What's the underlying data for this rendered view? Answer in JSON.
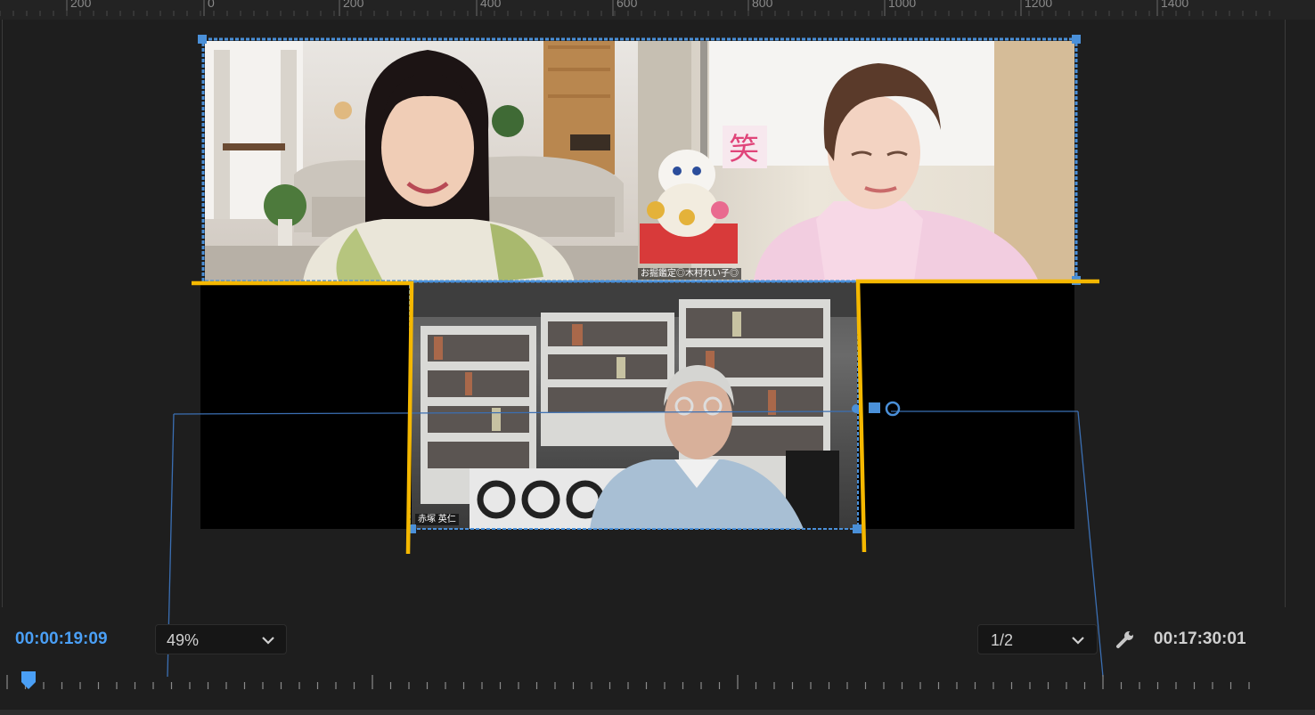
{
  "ruler": {
    "labels": [
      "200",
      "0",
      "200",
      "400",
      "600",
      "800",
      "1000",
      "1200",
      "1400"
    ]
  },
  "preview": {
    "participants": [
      {
        "name_tag": ""
      },
      {
        "name_tag": "お掘鑑定◎木村れい子◎"
      },
      {
        "name_tag": "赤塚 英仁"
      }
    ],
    "sign_text": "笑"
  },
  "controls": {
    "current_time": "00:00:19:09",
    "zoom_level": "49%",
    "resolution": "1/2",
    "duration": "00:17:30:01",
    "settings_icon": "wrench-icon",
    "dropdown_icon": "chevron-down-icon",
    "playhead_icon": "playhead-marker-icon"
  },
  "colors": {
    "accent_blue": "#4a9ff5",
    "crop_guide_yellow": "#f5b800",
    "selection_outline": "#4a90d9",
    "panel_bg": "#1e1e1e"
  }
}
